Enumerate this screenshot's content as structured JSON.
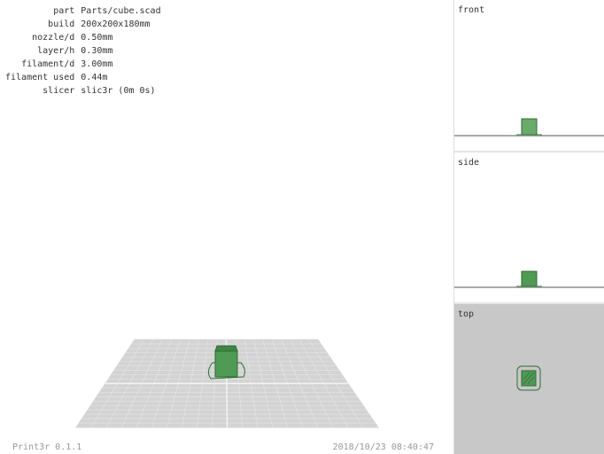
{
  "info": [
    {
      "key": "part",
      "value": "Parts/cube.scad"
    },
    {
      "key": "build",
      "value": "200x200x180mm"
    },
    {
      "key": "nozzle/d",
      "value": "0.50mm"
    },
    {
      "key": "layer/h",
      "value": "0.30mm"
    },
    {
      "key": "filament/d",
      "value": "3.00mm"
    },
    {
      "key": "filament used",
      "value": "0.44m"
    },
    {
      "key": "slicer",
      "value": "slic3r (0m 0s)"
    }
  ],
  "footer": {
    "version": "Print3r 0.1.1",
    "timestamp": "2018/10/23 08:40:47"
  },
  "views": {
    "front": "front",
    "side": "side",
    "top": "top"
  },
  "colors": {
    "part_fill": "#4f9a55",
    "part_edge": "#2f6b33",
    "bed": "#cfcfcf",
    "top_pane_bg": "#c8c8c8"
  }
}
